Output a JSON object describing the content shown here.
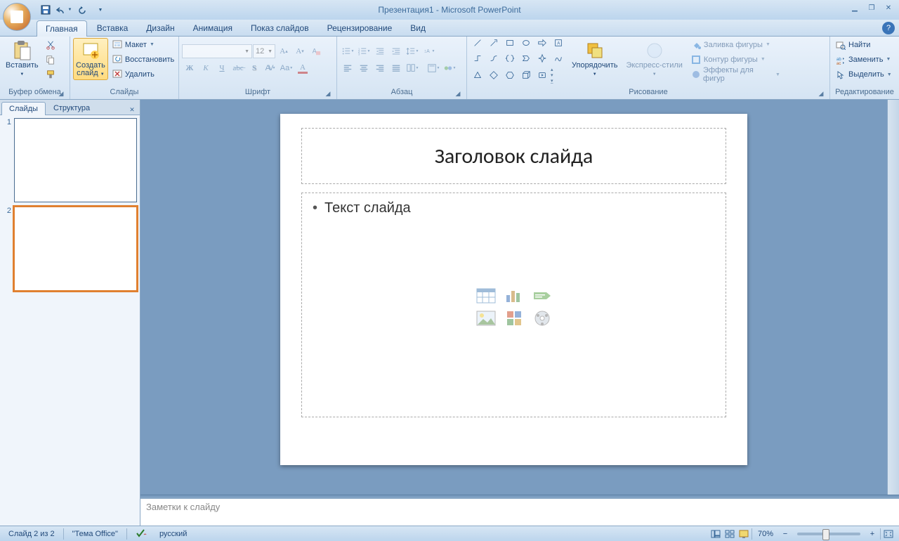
{
  "titlebar": {
    "title": "Презентация1 - Microsoft PowerPoint"
  },
  "qat": {
    "save": "Сохранить",
    "undo": "Отменить",
    "redo": "Повторить"
  },
  "tabs": {
    "home": "Главная",
    "insert": "Вставка",
    "design": "Дизайн",
    "animation": "Анимация",
    "slideshow": "Показ слайдов",
    "review": "Рецензирование",
    "view": "Вид"
  },
  "clipboard": {
    "paste": "Вставить",
    "group": "Буфер обмена"
  },
  "slides_group": {
    "new_slide": "Создать\nслайд",
    "layout": "Макет",
    "reset": "Восстановить",
    "delete": "Удалить",
    "group": "Слайды"
  },
  "font": {
    "size": "12",
    "group": "Шрифт"
  },
  "paragraph": {
    "group": "Абзац"
  },
  "drawing": {
    "arrange": "Упорядочить",
    "quick_styles": "Экспресс-стили",
    "shape_fill": "Заливка фигуры",
    "shape_outline": "Контур фигуры",
    "shape_effects": "Эффекты для фигур",
    "group": "Рисование"
  },
  "editing": {
    "find": "Найти",
    "replace": "Заменить",
    "select": "Выделить",
    "group": "Редактирование"
  },
  "sidepanel": {
    "slides_tab": "Слайды",
    "outline_tab": "Структура",
    "slide1": "1",
    "slide2": "2"
  },
  "slide": {
    "title": "Заголовок слайда",
    "body": "Текст слайда"
  },
  "notes": {
    "placeholder": "Заметки к слайду"
  },
  "status": {
    "slide_of": "Слайд 2 из 2",
    "theme": "\"Тема Office\"",
    "language": "русский",
    "zoom": "70%"
  }
}
